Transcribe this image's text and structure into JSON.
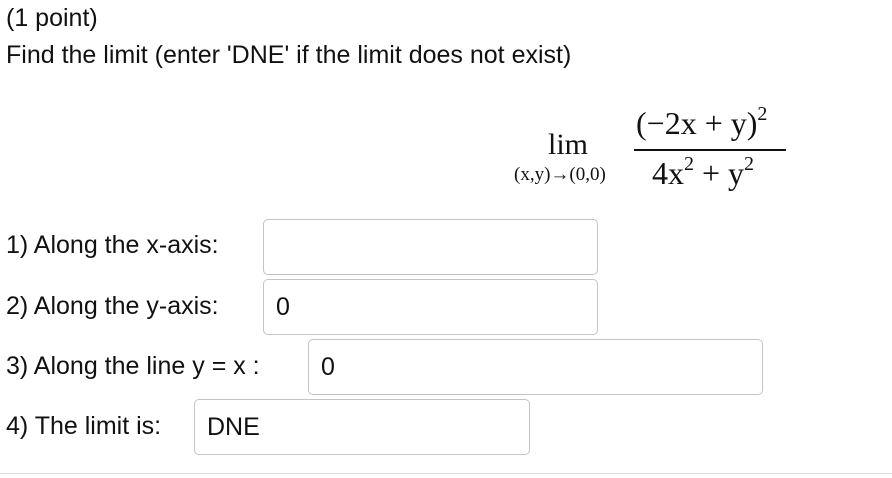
{
  "header": {
    "points": "(1 point)",
    "prompt": "Find the limit (enter 'DNE' if the limit does not exist)"
  },
  "math": {
    "lim_word": "lim",
    "lim_subscript": "(x,y)→(0,0)",
    "numerator_base": "(−2x + y)",
    "numerator_exp": "2",
    "denominator_a": "4x",
    "denominator_a_exp": "2",
    "denominator_mid": " + y",
    "denominator_b_exp": "2"
  },
  "questions": [
    {
      "label": "1) Along the x-axis:",
      "value": ""
    },
    {
      "label": "2) Along the y-axis:",
      "value": "0"
    },
    {
      "label": "3) Along the line y = x :",
      "value": "0"
    },
    {
      "label": "4) The limit is:",
      "value": "DNE"
    }
  ]
}
